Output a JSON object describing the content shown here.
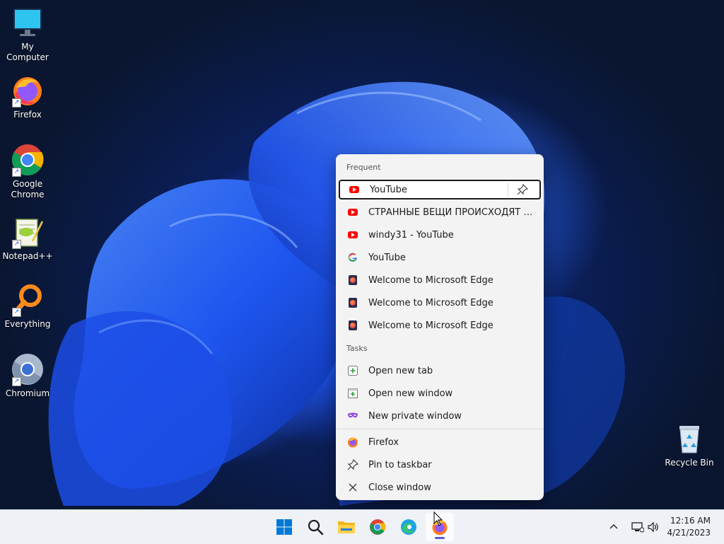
{
  "desktop": {
    "icons": [
      {
        "label": "My Computer"
      },
      {
        "label": "Firefox"
      },
      {
        "label": "Google Chrome"
      },
      {
        "label": "Notepad++"
      },
      {
        "label": "Everything"
      },
      {
        "label": "Chromium"
      },
      {
        "label": "Recycle Bin"
      }
    ]
  },
  "jumplist": {
    "frequent_label": "Frequent",
    "frequent": [
      {
        "title": "YouTube",
        "icon": "youtube-icon"
      },
      {
        "title": "СТРАННЫЕ ВЕЩИ ПРОИСХОДЯТ В...",
        "icon": "youtube-icon"
      },
      {
        "title": "windy31 - YouTube",
        "icon": "youtube-icon"
      },
      {
        "title": "YouTube",
        "icon": "google-icon"
      },
      {
        "title": "Welcome to Microsoft Edge",
        "icon": "edge-favicon-icon"
      },
      {
        "title": "Welcome to Microsoft Edge",
        "icon": "edge-favicon-icon"
      },
      {
        "title": "Welcome to Microsoft Edge",
        "icon": "edge-favicon-icon"
      }
    ],
    "tasks_label": "Tasks",
    "tasks": [
      {
        "title": "Open new tab",
        "icon": "new-tab-icon"
      },
      {
        "title": "Open new window",
        "icon": "new-window-icon"
      },
      {
        "title": "New private window",
        "icon": "private-mask-icon"
      }
    ],
    "app": [
      {
        "title": "Firefox",
        "icon": "firefox-icon"
      },
      {
        "title": "Pin to taskbar",
        "icon": "pin-icon"
      },
      {
        "title": "Close window",
        "icon": "close-icon"
      }
    ]
  },
  "taskbar": {
    "apps": [
      "start-icon",
      "search-icon",
      "file-explorer-icon",
      "chrome-icon",
      "edge-icon",
      "firefox-icon"
    ],
    "clock": {
      "time": "12:16 AM",
      "date": "4/21/2023"
    }
  },
  "colors": {
    "accent": "#5b5fc7",
    "youtube": "#ff0000"
  }
}
